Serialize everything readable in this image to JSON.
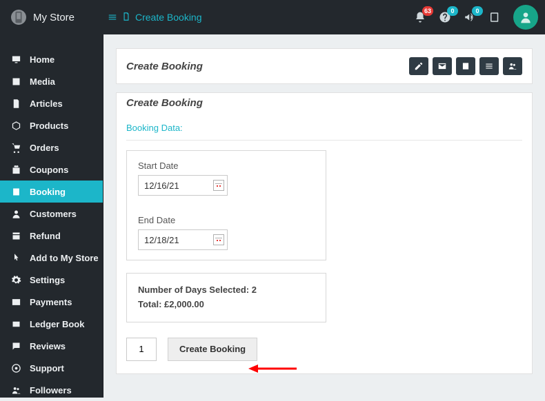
{
  "brand": {
    "name": "My Store"
  },
  "breadcrumb": {
    "page": "Create Booking"
  },
  "topbar": {
    "notifications_badge": "63",
    "help_badge": "0",
    "announce_badge": "0"
  },
  "sidebar": {
    "items": [
      {
        "label": "Home"
      },
      {
        "label": "Media"
      },
      {
        "label": "Articles"
      },
      {
        "label": "Products"
      },
      {
        "label": "Orders"
      },
      {
        "label": "Coupons"
      },
      {
        "label": "Booking"
      },
      {
        "label": "Customers"
      },
      {
        "label": "Refund"
      },
      {
        "label": "Add to My Store"
      },
      {
        "label": "Settings"
      },
      {
        "label": "Payments"
      },
      {
        "label": "Ledger Book"
      },
      {
        "label": "Reviews"
      },
      {
        "label": "Support"
      },
      {
        "label": "Followers"
      }
    ]
  },
  "panel": {
    "header_title": "Create Booking",
    "body_title": "Create Booking",
    "section_title": "Booking Data:",
    "start_date_label": "Start Date",
    "start_date_value": "12/16/21",
    "end_date_label": "End Date",
    "end_date_value": "12/18/21",
    "summary_days_label": "Number of Days Selected:",
    "summary_days_value": "2",
    "summary_total_label": "Total:",
    "summary_total_value": "£2,000.00",
    "qty_value": "1",
    "submit_label": "Create Booking"
  }
}
